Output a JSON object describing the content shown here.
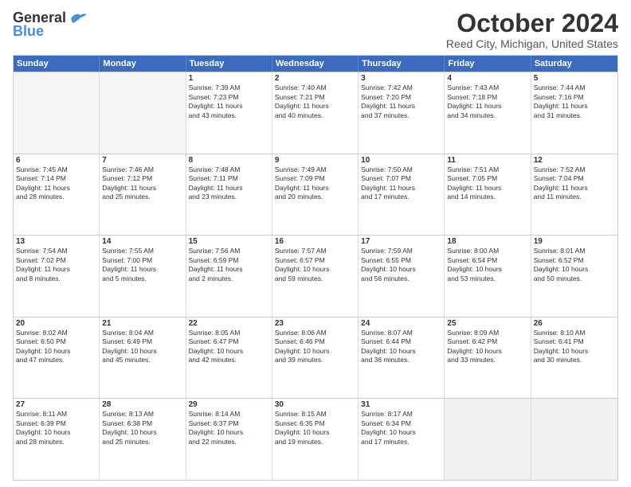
{
  "header": {
    "logo_general": "General",
    "logo_blue": "Blue",
    "title": "October 2024",
    "subtitle": "Reed City, Michigan, United States"
  },
  "days_of_week": [
    "Sunday",
    "Monday",
    "Tuesday",
    "Wednesday",
    "Thursday",
    "Friday",
    "Saturday"
  ],
  "weeks": [
    [
      {
        "day": "",
        "empty": true
      },
      {
        "day": "",
        "empty": true
      },
      {
        "day": "1",
        "lines": [
          "Sunrise: 7:39 AM",
          "Sunset: 7:23 PM",
          "Daylight: 11 hours",
          "and 43 minutes."
        ]
      },
      {
        "day": "2",
        "lines": [
          "Sunrise: 7:40 AM",
          "Sunset: 7:21 PM",
          "Daylight: 11 hours",
          "and 40 minutes."
        ]
      },
      {
        "day": "3",
        "lines": [
          "Sunrise: 7:42 AM",
          "Sunset: 7:20 PM",
          "Daylight: 11 hours",
          "and 37 minutes."
        ]
      },
      {
        "day": "4",
        "lines": [
          "Sunrise: 7:43 AM",
          "Sunset: 7:18 PM",
          "Daylight: 11 hours",
          "and 34 minutes."
        ]
      },
      {
        "day": "5",
        "lines": [
          "Sunrise: 7:44 AM",
          "Sunset: 7:16 PM",
          "Daylight: 11 hours",
          "and 31 minutes."
        ]
      }
    ],
    [
      {
        "day": "6",
        "lines": [
          "Sunrise: 7:45 AM",
          "Sunset: 7:14 PM",
          "Daylight: 11 hours",
          "and 28 minutes."
        ]
      },
      {
        "day": "7",
        "lines": [
          "Sunrise: 7:46 AM",
          "Sunset: 7:12 PM",
          "Daylight: 11 hours",
          "and 25 minutes."
        ]
      },
      {
        "day": "8",
        "lines": [
          "Sunrise: 7:48 AM",
          "Sunset: 7:11 PM",
          "Daylight: 11 hours",
          "and 23 minutes."
        ]
      },
      {
        "day": "9",
        "lines": [
          "Sunrise: 7:49 AM",
          "Sunset: 7:09 PM",
          "Daylight: 11 hours",
          "and 20 minutes."
        ]
      },
      {
        "day": "10",
        "lines": [
          "Sunrise: 7:50 AM",
          "Sunset: 7:07 PM",
          "Daylight: 11 hours",
          "and 17 minutes."
        ]
      },
      {
        "day": "11",
        "lines": [
          "Sunrise: 7:51 AM",
          "Sunset: 7:05 PM",
          "Daylight: 11 hours",
          "and 14 minutes."
        ]
      },
      {
        "day": "12",
        "lines": [
          "Sunrise: 7:52 AM",
          "Sunset: 7:04 PM",
          "Daylight: 11 hours",
          "and 11 minutes."
        ]
      }
    ],
    [
      {
        "day": "13",
        "lines": [
          "Sunrise: 7:54 AM",
          "Sunset: 7:02 PM",
          "Daylight: 11 hours",
          "and 8 minutes."
        ]
      },
      {
        "day": "14",
        "lines": [
          "Sunrise: 7:55 AM",
          "Sunset: 7:00 PM",
          "Daylight: 11 hours",
          "and 5 minutes."
        ]
      },
      {
        "day": "15",
        "lines": [
          "Sunrise: 7:56 AM",
          "Sunset: 6:59 PM",
          "Daylight: 11 hours",
          "and 2 minutes."
        ]
      },
      {
        "day": "16",
        "lines": [
          "Sunrise: 7:57 AM",
          "Sunset: 6:57 PM",
          "Daylight: 10 hours",
          "and 59 minutes."
        ]
      },
      {
        "day": "17",
        "lines": [
          "Sunrise: 7:59 AM",
          "Sunset: 6:55 PM",
          "Daylight: 10 hours",
          "and 56 minutes."
        ]
      },
      {
        "day": "18",
        "lines": [
          "Sunrise: 8:00 AM",
          "Sunset: 6:54 PM",
          "Daylight: 10 hours",
          "and 53 minutes."
        ]
      },
      {
        "day": "19",
        "lines": [
          "Sunrise: 8:01 AM",
          "Sunset: 6:52 PM",
          "Daylight: 10 hours",
          "and 50 minutes."
        ]
      }
    ],
    [
      {
        "day": "20",
        "lines": [
          "Sunrise: 8:02 AM",
          "Sunset: 6:50 PM",
          "Daylight: 10 hours",
          "and 47 minutes."
        ]
      },
      {
        "day": "21",
        "lines": [
          "Sunrise: 8:04 AM",
          "Sunset: 6:49 PM",
          "Daylight: 10 hours",
          "and 45 minutes."
        ]
      },
      {
        "day": "22",
        "lines": [
          "Sunrise: 8:05 AM",
          "Sunset: 6:47 PM",
          "Daylight: 10 hours",
          "and 42 minutes."
        ]
      },
      {
        "day": "23",
        "lines": [
          "Sunrise: 8:06 AM",
          "Sunset: 6:46 PM",
          "Daylight: 10 hours",
          "and 39 minutes."
        ]
      },
      {
        "day": "24",
        "lines": [
          "Sunrise: 8:07 AM",
          "Sunset: 6:44 PM",
          "Daylight: 10 hours",
          "and 36 minutes."
        ]
      },
      {
        "day": "25",
        "lines": [
          "Sunrise: 8:09 AM",
          "Sunset: 6:42 PM",
          "Daylight: 10 hours",
          "and 33 minutes."
        ]
      },
      {
        "day": "26",
        "lines": [
          "Sunrise: 8:10 AM",
          "Sunset: 6:41 PM",
          "Daylight: 10 hours",
          "and 30 minutes."
        ]
      }
    ],
    [
      {
        "day": "27",
        "lines": [
          "Sunrise: 8:11 AM",
          "Sunset: 6:39 PM",
          "Daylight: 10 hours",
          "and 28 minutes."
        ]
      },
      {
        "day": "28",
        "lines": [
          "Sunrise: 8:13 AM",
          "Sunset: 6:38 PM",
          "Daylight: 10 hours",
          "and 25 minutes."
        ]
      },
      {
        "day": "29",
        "lines": [
          "Sunrise: 8:14 AM",
          "Sunset: 6:37 PM",
          "Daylight: 10 hours",
          "and 22 minutes."
        ]
      },
      {
        "day": "30",
        "lines": [
          "Sunrise: 8:15 AM",
          "Sunset: 6:35 PM",
          "Daylight: 10 hours",
          "and 19 minutes."
        ]
      },
      {
        "day": "31",
        "lines": [
          "Sunrise: 8:17 AM",
          "Sunset: 6:34 PM",
          "Daylight: 10 hours",
          "and 17 minutes."
        ]
      },
      {
        "day": "",
        "empty": true,
        "shaded": true
      },
      {
        "day": "",
        "empty": true,
        "shaded": true
      }
    ]
  ]
}
